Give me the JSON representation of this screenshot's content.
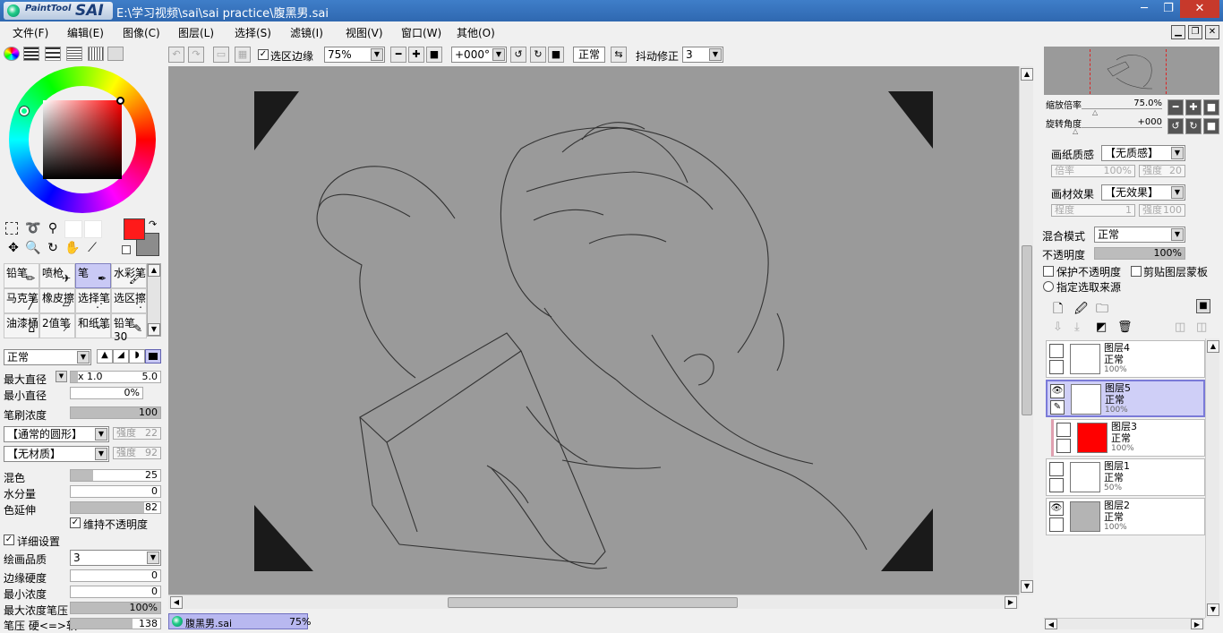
{
  "window": {
    "app_logo_small": "PaintTool",
    "app_logo_big": "SAI",
    "title": "E:\\学习视频\\sai\\sai practice\\腹黑男.sai",
    "minimize": "─",
    "maximize": "❐",
    "close": "✕"
  },
  "menu": [
    "文件(F)",
    "编辑(E)",
    "图像(C)",
    "图层(L)",
    "选择(S)",
    "滤镜(I)",
    "视图(V)",
    "窗口(W)",
    "其他(O)"
  ],
  "toolbar": {
    "select_edge_label": "选区边缘",
    "select_edge_checked": true,
    "zoom": "75%",
    "rotation": "+000°",
    "blend_mode": "正常",
    "stabilizer_label": "抖动修正",
    "stabilizer_value": "3"
  },
  "tools": {
    "brushes": [
      {
        "label": "铅笔",
        "icon": "✏"
      },
      {
        "label": "喷枪",
        "icon": "✈"
      },
      {
        "label": "笔",
        "icon": "✒"
      },
      {
        "label": "水彩笔",
        "icon": "🖌"
      },
      {
        "label": "马克笔",
        "icon": "╱"
      },
      {
        "label": "橡皮擦",
        "icon": "▱"
      },
      {
        "label": "选择笔",
        "icon": "⋰"
      },
      {
        "label": "选区擦",
        "icon": "⋱"
      },
      {
        "label": "油漆桶",
        "icon": "⌂"
      },
      {
        "label": "2值笔",
        "icon": "⟋"
      },
      {
        "label": "和纸笔",
        "icon": "〰"
      },
      {
        "label": "铅笔30",
        "icon": "✎"
      }
    ],
    "selected_brush": "笔"
  },
  "brush_settings": {
    "mode": "正常",
    "max_diameter_label": "最大直径",
    "max_diameter_mult": "x 1.0",
    "max_diameter_value": "5.0",
    "min_diameter_label": "最小直径",
    "min_diameter_value": "0%",
    "density_label": "笔刷浓度",
    "density_value": "100",
    "shape": "【通常的圆形】",
    "shape_strength_label": "强度",
    "shape_strength": "22",
    "texture": "【无材质】",
    "texture_strength_label": "强度",
    "texture_strength": "92",
    "blend_label": "混色",
    "blend_value": "25",
    "water_label": "水分量",
    "water_value": "0",
    "stretch_label": "色延伸",
    "stretch_value": "82",
    "keep_opacity_label": "维持不透明度",
    "detail_label": "详细设置",
    "quality_label": "绘画品质",
    "quality_value": "3",
    "edge_hardness_label": "边缘硬度",
    "edge_hardness_value": "0",
    "min_density_label": "最小浓度",
    "min_density_value": "0",
    "max_density_pressure_label": "最大浓度笔压",
    "max_density_pressure_value": "100%",
    "pressure_label": "笔压 硬<=>软",
    "pressure_value": "138"
  },
  "colors": {
    "foreground": "#ff1a1a",
    "background": "#8c8c8c",
    "canvas_bg": "#9a9a9a",
    "selected_layer": "#cfcff7"
  },
  "file_tab": {
    "name": "腹黑男.sai",
    "zoom": "75%"
  },
  "navigator": {
    "zoom_label": "缩放倍率",
    "zoom_value": "75.0%",
    "rotate_label": "旋转角度",
    "rotate_value": "+000"
  },
  "layer_props": {
    "paper_texture_label": "画纸质感",
    "paper_texture_value": "【无质感】",
    "paper_scale_label": "倍率",
    "paper_scale_value": "100%",
    "paper_strength_label": "强度",
    "paper_strength_value": "20",
    "material_effect_label": "画材效果",
    "material_effect_value": "【无效果】",
    "material_degree_label": "程度",
    "material_degree_value": "1",
    "material_strength_label": "强度",
    "material_strength_value": "100",
    "blend_mode_label": "混合模式",
    "blend_mode_value": "正常",
    "opacity_label": "不透明度",
    "opacity_value": "100%",
    "protect_opacity_label": "保护不透明度",
    "clip_mask_label": "剪贴图层蒙板",
    "selection_source_label": "指定选取来源"
  },
  "layers": [
    {
      "name": "图层4",
      "mode": "正常",
      "opacity": "100%",
      "visible": false,
      "thumb": "#ffffff"
    },
    {
      "name": "图层5",
      "mode": "正常",
      "opacity": "100%",
      "visible": true,
      "thumb": "#ffffff"
    },
    {
      "name": "图层3",
      "mode": "正常",
      "opacity": "100%",
      "visible": false,
      "thumb": "#ff0000"
    },
    {
      "name": "图层1",
      "mode": "正常",
      "opacity": "50%",
      "visible": false,
      "thumb": "#ffffff"
    },
    {
      "name": "图层2",
      "mode": "正常",
      "opacity": "100%",
      "visible": true,
      "thumb": "#b4b4b4"
    }
  ]
}
